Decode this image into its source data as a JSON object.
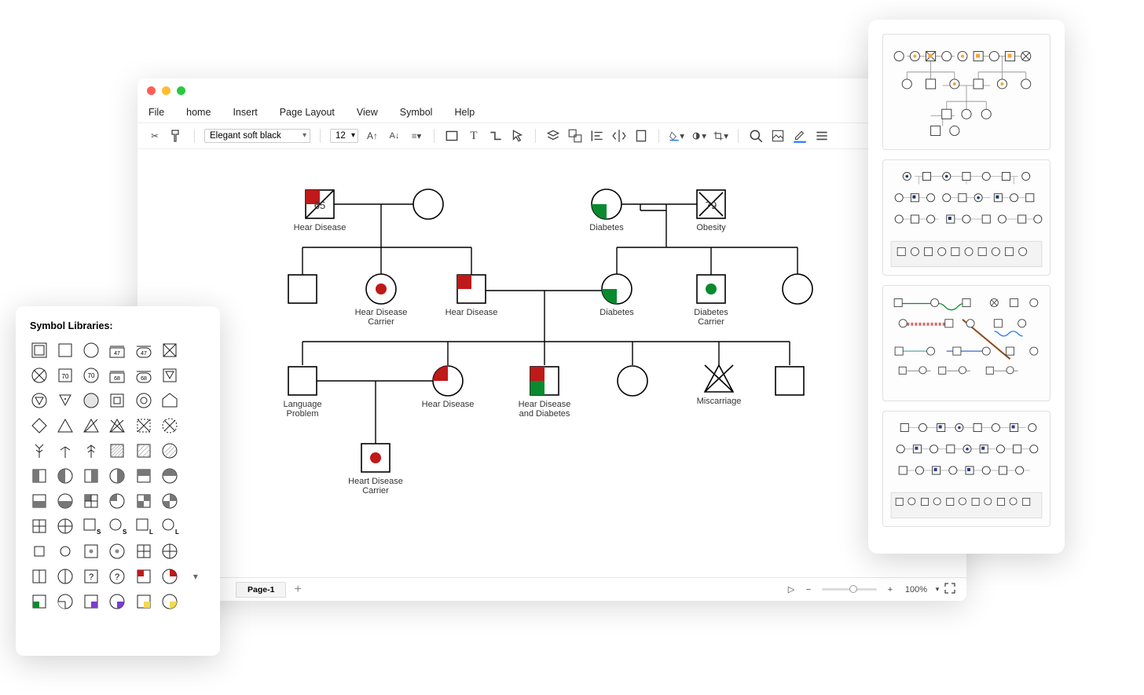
{
  "menubar": {
    "file": "File",
    "home": "home",
    "insert": "Insert",
    "pageLayout": "Page Layout",
    "view": "View",
    "symbol": "Symbol",
    "help": "Help"
  },
  "toolbar": {
    "font": "Elegant soft black",
    "fontSize": "12"
  },
  "statusbar": {
    "page": "Page-1",
    "zoom": "100%"
  },
  "symPanel": {
    "title": "Symbol Libraries:"
  },
  "symbolNumbers": {
    "n70a": "70",
    "n70b": "70",
    "n47a": "47",
    "n47b": "47",
    "n68a": "68",
    "n68b": "68",
    "q1": "?",
    "q2": "?",
    "s1": "S",
    "s2": "S",
    "l1": "L",
    "l2": "L"
  },
  "canvas": {
    "gen1": {
      "p1": {
        "age": "65",
        "label": "Hear Disease"
      },
      "p3": {
        "label": "Diabetes"
      },
      "p4": {
        "age": "79",
        "label": "Obesity"
      }
    },
    "gen2": {
      "p2": {
        "label": "Hear Disease\nCarrier"
      },
      "p3": {
        "label": "Hear Disease"
      },
      "p4": {
        "label": "Diabetes"
      },
      "p5": {
        "label": "Diabetes\nCarrier"
      }
    },
    "gen3": {
      "p1": {
        "label": "Language\nProblem"
      },
      "p2": {
        "label": "Hear Disease"
      },
      "p3": {
        "label": "Hear Disease\nand Diabetes"
      },
      "p5": {
        "label": "Miscarriage"
      }
    },
    "gen4": {
      "p1": {
        "label": "Heart Disease\nCarrier"
      }
    }
  }
}
